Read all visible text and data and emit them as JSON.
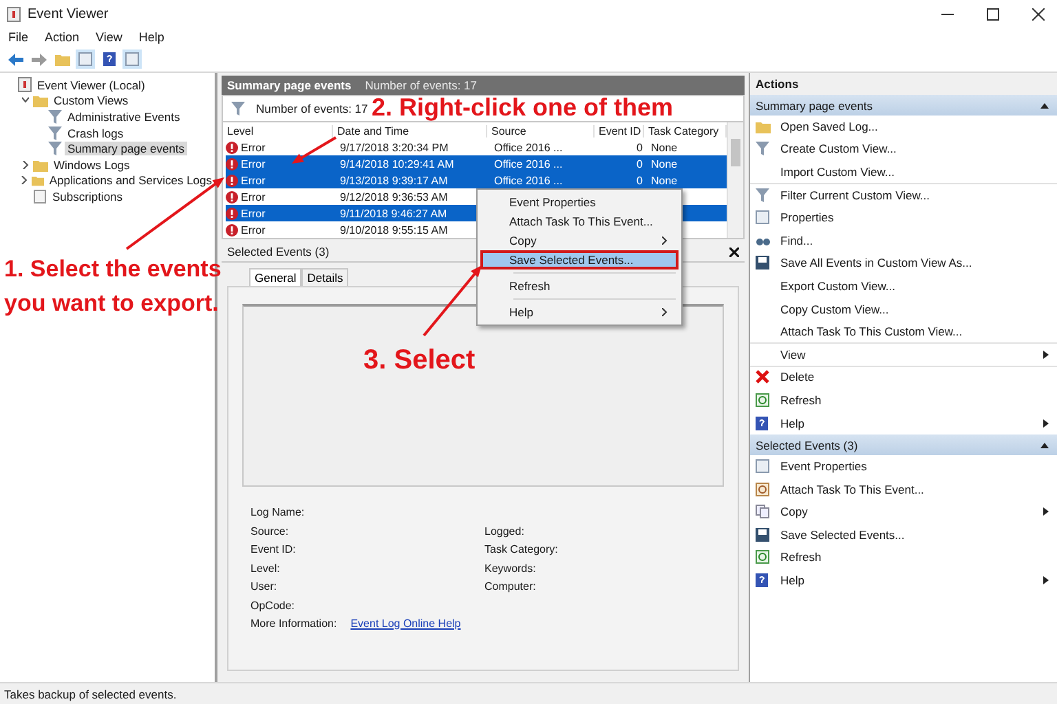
{
  "window": {
    "title": "Event Viewer"
  },
  "menu": [
    "File",
    "Action",
    "View",
    "Help"
  ],
  "tree": [
    {
      "label": "Event Viewer (Local)",
      "kind": "viewer",
      "selected": false,
      "children": [
        {
          "label": "Custom Views",
          "kind": "folder",
          "expanded": true,
          "selected": false,
          "children": [
            {
              "label": "Administrative Events",
              "kind": "filter",
              "selected": false
            },
            {
              "label": "Crash logs",
              "kind": "filter",
              "selected": false
            },
            {
              "label": "Summary page events",
              "kind": "filter",
              "selected": true
            }
          ]
        },
        {
          "label": "Windows Logs",
          "kind": "folder",
          "expanded": false,
          "selected": false
        },
        {
          "label": "Applications and Services Logs",
          "kind": "folder",
          "expanded": false,
          "selected": false
        },
        {
          "label": "Subscriptions",
          "kind": "doc",
          "selected": false
        }
      ]
    }
  ],
  "center": {
    "title": "Summary page events",
    "count": "Number of events: 17",
    "filter_count": "Number of events: 17",
    "columns": [
      "Level",
      "Date and Time",
      "Source",
      "Event ID",
      "Task Category"
    ],
    "rows": [
      {
        "level": "Error",
        "date": "9/17/2018 3:20:34 PM",
        "source": "Office 2016 ...",
        "event_id": "0",
        "category": "None",
        "selected": false
      },
      {
        "level": "Error",
        "date": "9/14/2018 10:29:41 AM",
        "source": "Office 2016 ...",
        "event_id": "0",
        "category": "None",
        "selected": true
      },
      {
        "level": "Error",
        "date": "9/13/2018 9:39:17 AM",
        "source": "Office 2016 ...",
        "event_id": "0",
        "category": "None",
        "selected": true
      },
      {
        "level": "Error",
        "date": "9/12/2018 9:36:53 AM",
        "selected": false
      },
      {
        "level": "Error",
        "date": "9/11/2018 9:46:27 AM",
        "selected": true
      },
      {
        "level": "Error",
        "date": "9/10/2018 9:55:15 AM",
        "selected": false
      }
    ],
    "details_title": "Selected Events (3)",
    "tabs": [
      {
        "label": "General",
        "selected": true
      },
      {
        "label": "Details",
        "selected": false
      }
    ],
    "fields_left": [
      "Log Name:",
      "Source:",
      "Event ID:",
      "Level:",
      "User:",
      "OpCode:"
    ],
    "fields_right": [
      "Logged:",
      "Task Category:",
      "Keywords:",
      "Computer:"
    ],
    "more_info": {
      "label": "More Information:",
      "link": "Event Log Online Help"
    }
  },
  "context_menu": [
    {
      "kind": "item",
      "label": "Event Properties",
      "submenu": false,
      "selected": false
    },
    {
      "kind": "item",
      "label": "Attach Task To This Event...",
      "submenu": false,
      "selected": false
    },
    {
      "kind": "item",
      "label": "Copy",
      "submenu": true,
      "selected": false
    },
    {
      "kind": "item",
      "label": "Save Selected Events...",
      "submenu": false,
      "selected": true
    },
    {
      "kind": "separator"
    },
    {
      "kind": "item",
      "label": "Refresh",
      "submenu": false,
      "selected": false
    },
    {
      "kind": "separator"
    },
    {
      "kind": "item",
      "label": "Help",
      "submenu": true,
      "selected": false
    }
  ],
  "actions": {
    "title": "Actions",
    "sections": [
      {
        "title": "Summary page events",
        "items": [
          {
            "label": "Open Saved Log...",
            "kind": "folder",
            "submenu": false,
            "separator_after": false
          },
          {
            "label": "Create Custom View...",
            "kind": "funnel",
            "submenu": false,
            "separator_after": false
          },
          {
            "label": "Import Custom View...",
            "kind": "plain",
            "submenu": false,
            "separator_after": true
          },
          {
            "label": "Filter Current Custom View...",
            "kind": "funnel",
            "submenu": false,
            "separator_after": false
          },
          {
            "label": "Properties",
            "kind": "props",
            "submenu": false,
            "separator_after": false
          },
          {
            "label": "Find...",
            "kind": "find",
            "submenu": false,
            "separator_after": false
          },
          {
            "label": "Save All Events in Custom View As...",
            "kind": "save",
            "submenu": false,
            "separator_after": false
          },
          {
            "label": "Export Custom View...",
            "kind": "plain",
            "submenu": false,
            "separator_after": false
          },
          {
            "label": "Copy Custom View...",
            "kind": "plain",
            "submenu": false,
            "separator_after": false
          },
          {
            "label": "Attach Task To This Custom View...",
            "kind": "plain",
            "submenu": false,
            "separator_after": true
          },
          {
            "label": "View",
            "kind": "plain",
            "submenu": true,
            "separator_after": true
          },
          {
            "label": "Delete",
            "kind": "delete",
            "submenu": false,
            "separator_after": false
          },
          {
            "label": "Refresh",
            "kind": "refresh",
            "submenu": false,
            "separator_after": false
          },
          {
            "label": "Help",
            "kind": "help",
            "submenu": true,
            "separator_after": false
          }
        ]
      },
      {
        "title": "Selected Events (3)",
        "items": [
          {
            "label": "Event Properties",
            "kind": "props",
            "submenu": false,
            "separator_after": false
          },
          {
            "label": "Attach Task To This Event...",
            "kind": "task",
            "submenu": false,
            "separator_after": false
          },
          {
            "label": "Copy",
            "kind": "copy",
            "submenu": true,
            "separator_after": false
          },
          {
            "label": "Save Selected Events...",
            "kind": "save",
            "submenu": false,
            "separator_after": false
          },
          {
            "label": "Refresh",
            "kind": "refresh",
            "submenu": false,
            "separator_after": false
          },
          {
            "label": "Help",
            "kind": "help",
            "submenu": true,
            "separator_after": false
          }
        ]
      }
    ]
  },
  "status_bar": "Takes backup of selected events.",
  "annotations": [
    {
      "kind": "step1",
      "lines": [
        "1. Select the events",
        "you want to export."
      ]
    },
    {
      "kind": "step2",
      "lines": [
        "2. Right-click one of them"
      ]
    },
    {
      "kind": "step3",
      "lines": [
        "3. Select"
      ]
    }
  ]
}
